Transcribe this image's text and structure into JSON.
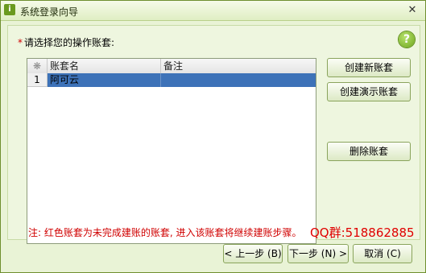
{
  "window": {
    "title": "系统登录向导",
    "close_glyph": "✕"
  },
  "prompt": {
    "required_mark": "*",
    "label": "请选择您的操作账套:"
  },
  "help": {
    "glyph": "?"
  },
  "grid": {
    "columns": [
      "❋",
      "账套名",
      "备注"
    ],
    "rows": [
      {
        "index": "1",
        "name": "阿可云",
        "remark": ""
      }
    ]
  },
  "side_buttons": {
    "create_new": "创建新账套",
    "create_demo": "创建演示账套",
    "delete": "删除账套"
  },
  "note": "注: 红色账套为未完成建账的账套, 进入该账套将继续建账步骤。",
  "watermark": "QQ群:518862885",
  "footer": {
    "prev": "< 上一步 (B)",
    "next": "下一步 (N) >",
    "cancel": "取消 (C)"
  },
  "colors": {
    "selected_row": "#3d72b8",
    "note_red": "#d00000",
    "accent_green": "#6ea51d"
  }
}
